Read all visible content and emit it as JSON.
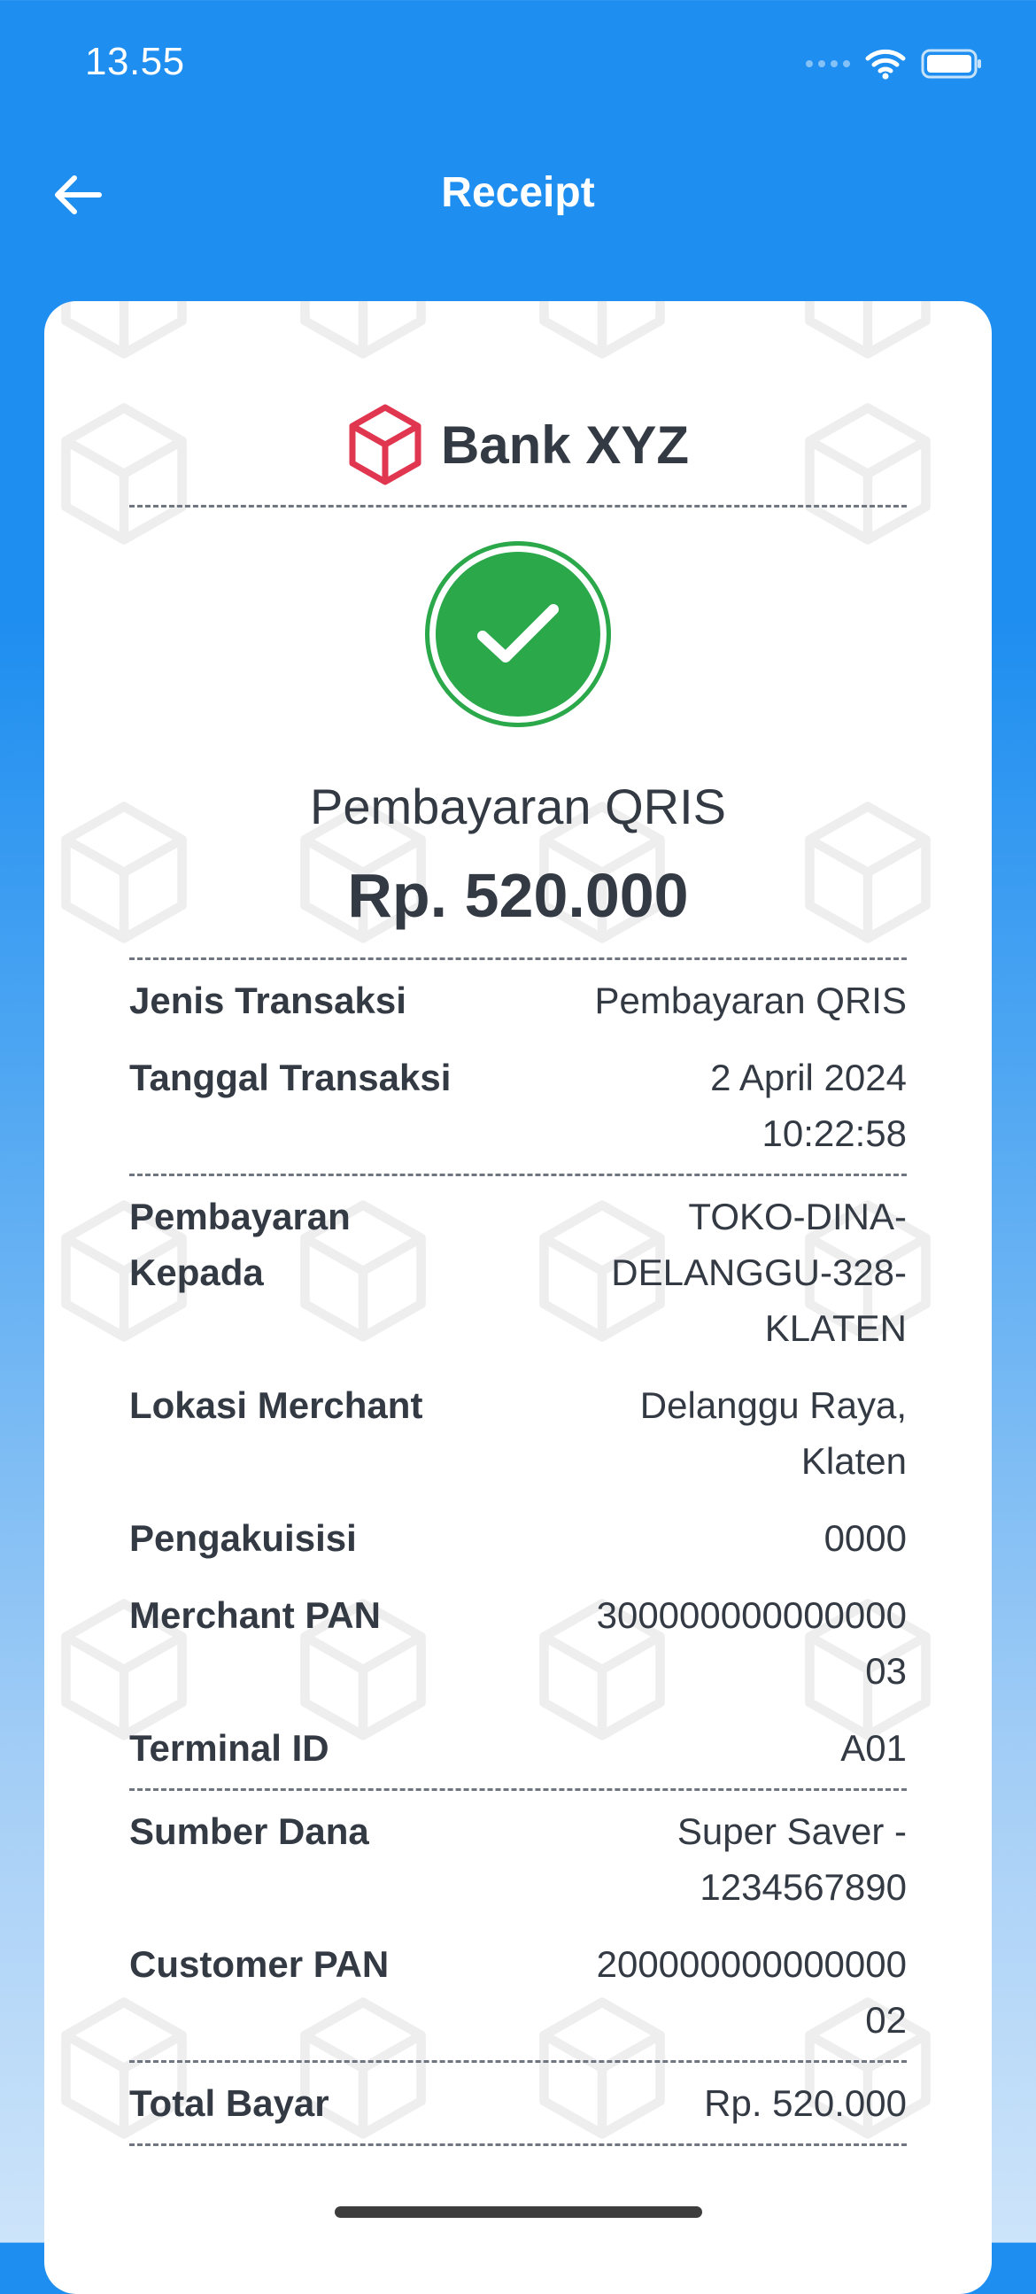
{
  "status_bar": {
    "time": "13.55",
    "icons": [
      "signal-icon",
      "wifi-icon",
      "battery-icon"
    ]
  },
  "app_bar": {
    "title": "Receipt",
    "back_icon": "arrow-left-icon"
  },
  "receipt": {
    "bank_name": "Bank XYZ",
    "logo_icon": "cube-icon",
    "status_icon": "check-circle-icon",
    "transaction_title": "Pembayaran QRIS",
    "amount": "Rp. 520.000",
    "sections": [
      [
        {
          "label": "Jenis Transaksi",
          "value": "Pembayaran QRIS"
        },
        {
          "label": "Tanggal Transaksi",
          "value": "2 April 2024\n10:22:58"
        }
      ],
      [
        {
          "label": "Pembayaran Kepada",
          "value": "TOKO-DINA-\nDELANGGU-328-\nKLATEN"
        },
        {
          "label": "Lokasi Merchant",
          "value": "Delanggu Raya,\nKlaten"
        },
        {
          "label": "Pengakuisisi",
          "value": "0000"
        },
        {
          "label": "Merchant PAN",
          "value": "300000000000000\n03"
        },
        {
          "label": "Terminal ID",
          "value": "A01"
        }
      ],
      [
        {
          "label": "Sumber Dana",
          "value": "Super Saver -\n1234567890"
        },
        {
          "label": "Customer PAN",
          "value": "200000000000000\n02"
        }
      ],
      [
        {
          "label": "Total Bayar",
          "value": "Rp. 520.000"
        }
      ]
    ]
  },
  "colors": {
    "header_blue": "#1e8ef0",
    "success_green": "#2aa84a",
    "logo_red": "#e0364f",
    "text_dark": "#333a43"
  }
}
